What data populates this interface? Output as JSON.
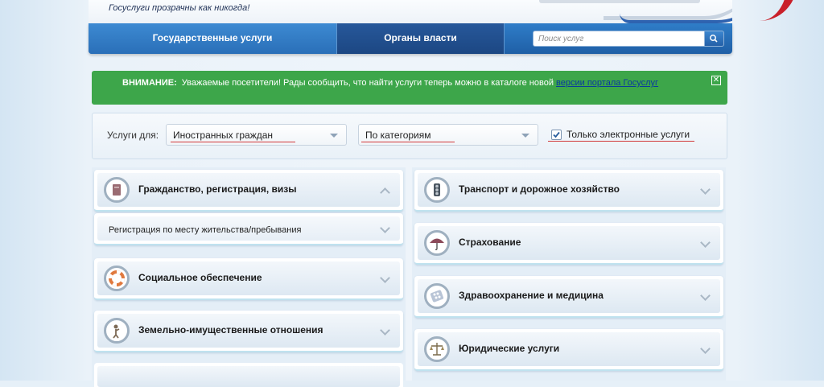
{
  "header": {
    "slogan": "Госуслуги прозрачны как никогда!"
  },
  "nav": {
    "tabs": [
      {
        "label": "Государственные услуги"
      },
      {
        "label": "Органы власти"
      }
    ],
    "search_placeholder": "Поиск услуг"
  },
  "notice": {
    "label": "ВНИМАНИЕ:",
    "text": "Уважаемые посетители! Рады сообщить, что найти услуги теперь можно в каталоге новой ",
    "link_text": "версии портала Госуслуг",
    "bg_color": "#3da64a"
  },
  "filter": {
    "label": "Услуги для:",
    "audience_value": "Иностранных граждан",
    "mode_value": "По категориям",
    "electronic_only_label": "Только электронные услуги",
    "electronic_only_checked": true
  },
  "categories": {
    "left": [
      {
        "title": "Гражданство, регистрация, визы",
        "icon": "passport-icon",
        "expanded": true,
        "subitems": [
          {
            "title": "Регистрация по месту жительства/пребывания"
          }
        ]
      },
      {
        "title": "Социальное обеспечение",
        "icon": "lifebuoy-icon"
      },
      {
        "title": "Земельно-имущественные отношения",
        "icon": "land-surveyor-icon"
      }
    ],
    "right": [
      {
        "title": "Транспорт и дорожное хозяйство",
        "icon": "traffic-light-icon"
      },
      {
        "title": "Страхование",
        "icon": "umbrella-icon"
      },
      {
        "title": "Здравоохранение и медицина",
        "icon": "pills-icon"
      },
      {
        "title": "Юридические услуги",
        "icon": "scales-icon"
      }
    ]
  }
}
